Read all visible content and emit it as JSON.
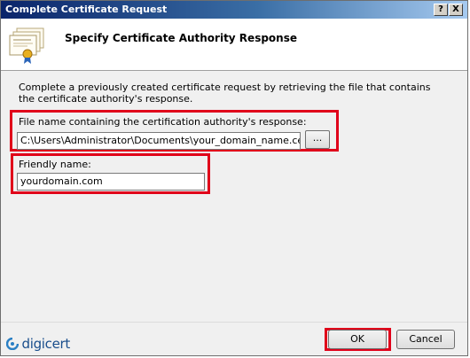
{
  "window": {
    "title": "Complete Certificate Request",
    "help_button": "?",
    "close_button": "X"
  },
  "header": {
    "icon": "certificate-stack-icon",
    "title": "Specify Certificate Authority Response"
  },
  "description": "Complete a previously created certificate request by retrieving the file that contains the certificate authority's response.",
  "file_field": {
    "label": "File name containing the certification authority's response:",
    "value": "C:\\Users\\Administrator\\Documents\\your_domain_name.cer",
    "browse_label": "..."
  },
  "friendly_field": {
    "label": "Friendly name:",
    "value": "yourdomain.com"
  },
  "footer": {
    "logo_text": "digicert",
    "ok_label": "OK",
    "cancel_label": "Cancel"
  },
  "colors": {
    "highlight": "#e0001a",
    "titlebar": "#0a246a",
    "logo": "#1a4e8c"
  }
}
